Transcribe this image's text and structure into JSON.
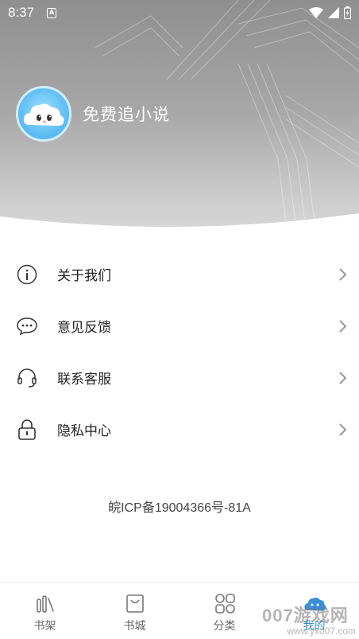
{
  "statusbar": {
    "time": "8:37"
  },
  "profile": {
    "nickname": "免费追小说",
    "avatar_icon": "cloud-mascot-icon"
  },
  "menu": {
    "items": [
      {
        "label": "关于我们",
        "icon": "info-icon"
      },
      {
        "label": "意见反馈",
        "icon": "chat-icon"
      },
      {
        "label": "联系客服",
        "icon": "headset-icon"
      },
      {
        "label": "隐私中心",
        "icon": "lock-icon"
      }
    ]
  },
  "footer": {
    "icp": "皖ICP备19004366号-81A"
  },
  "tabbar": {
    "tabs": [
      {
        "label": "书架",
        "icon": "bookshelf-icon"
      },
      {
        "label": "书城",
        "icon": "shopping-bag-icon"
      },
      {
        "label": "分类",
        "icon": "grid-icon"
      },
      {
        "label": "我的",
        "icon": "cloud-icon"
      }
    ],
    "active_color": "#3a8fd8"
  },
  "watermark": {
    "main": "007游戏网",
    "sub": "www.yx007.com"
  }
}
